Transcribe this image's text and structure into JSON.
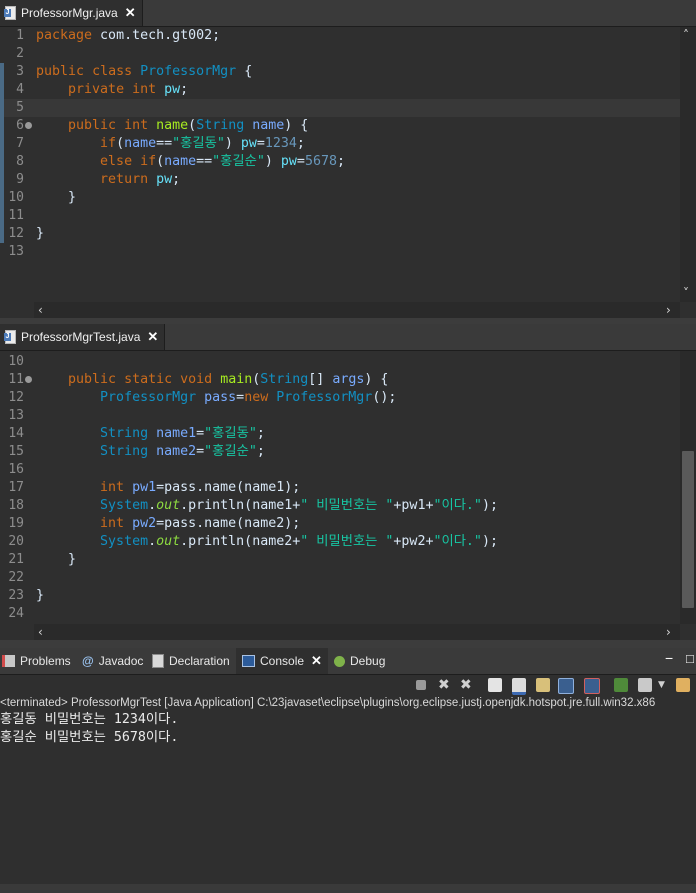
{
  "editor1": {
    "tab_label": "ProfessorMgr.java",
    "close": "✕",
    "lines": [
      "1",
      "2",
      "3",
      "4",
      "5",
      "6",
      "7",
      "8",
      "9",
      "10",
      "11",
      "12",
      "13"
    ],
    "code": {
      "l1a": "package",
      "l1b": " com.tech.gt002;",
      "l3a": "public",
      "l3b": " ",
      "l3c": "class",
      "l3d": " ",
      "l3e": "ProfessorMgr",
      "l3f": " {",
      "l4a": "    ",
      "l4b": "private",
      "l4c": " ",
      "l4d": "int",
      "l4e": " ",
      "l4f": "pw",
      "l4g": ";",
      "l6a": "    ",
      "l6b": "public",
      "l6c": " ",
      "l6d": "int",
      "l6e": " ",
      "l6f": "name",
      "l6g": "(",
      "l6h": "String",
      "l6i": " ",
      "l6j": "name",
      "l6k": ") {",
      "l7a": "        ",
      "l7b": "if",
      "l7c": "(",
      "l7d": "name",
      "l7e": "==",
      "l7f": "\"홍길동\"",
      "l7g": ") ",
      "l7h": "pw",
      "l7i": "=",
      "l7j": "1234",
      "l7k": ";",
      "l8a": "        ",
      "l8b": "else",
      "l8c": " ",
      "l8d": "if",
      "l8e": "(",
      "l8f": "name",
      "l8g": "==",
      "l8h": "\"홍길순\"",
      "l8i": ") ",
      "l8j": "pw",
      "l8k": "=",
      "l8l": "5678",
      "l8m": ";",
      "l9a": "        ",
      "l9b": "return",
      "l9c": " ",
      "l9d": "pw",
      "l9e": ";",
      "l10": "    }",
      "l12": "}"
    }
  },
  "editor2": {
    "tab_label": "ProfessorMgrTest.java",
    "close": "✕",
    "lines": [
      "10",
      "11",
      "12",
      "13",
      "14",
      "15",
      "16",
      "17",
      "18",
      "19",
      "20",
      "21",
      "22",
      "23",
      "24"
    ],
    "code": {
      "l11a": "    ",
      "l11b": "public",
      "l11c": " ",
      "l11d": "static",
      "l11e": " ",
      "l11f": "void",
      "l11g": " ",
      "l11h": "main",
      "l11i": "(",
      "l11j": "String",
      "l11k": "[] ",
      "l11l": "args",
      "l11m": ") {",
      "l12a": "        ",
      "l12b": "ProfessorMgr",
      "l12c": " ",
      "l12d": "pass",
      "l12e": "=",
      "l12f": "new",
      "l12g": " ",
      "l12h": "ProfessorMgr",
      "l12i": "();",
      "l14a": "        ",
      "l14b": "String",
      "l14c": " ",
      "l14d": "name1",
      "l14e": "=",
      "l14f": "\"홍길동\"",
      "l14g": ";",
      "l15a": "        ",
      "l15b": "String",
      "l15c": " ",
      "l15d": "name2",
      "l15e": "=",
      "l15f": "\"홍길순\"",
      "l15g": ";",
      "l17a": "        ",
      "l17b": "int",
      "l17c": " ",
      "l17d": "pw1",
      "l17e": "=pass.name(name1);",
      "l18a": "        ",
      "l18b": "System",
      "l18c": ".",
      "l18d": "out",
      "l18e": ".println(name1+",
      "l18f": "\" 비밀번호는 \"",
      "l18g": "+pw1+",
      "l18h": "\"이다.\"",
      "l18i": ");",
      "l19a": "        ",
      "l19b": "int",
      "l19c": " ",
      "l19d": "pw2",
      "l19e": "=pass.name(name2);",
      "l20a": "        ",
      "l20b": "System",
      "l20c": ".",
      "l20d": "out",
      "l20e": ".println(name2+",
      "l20f": "\" 비밀번호는 \"",
      "l20g": "+pw2+",
      "l20h": "\"이다.\"",
      "l20i": ");",
      "l21": "    }",
      "l23": "}"
    }
  },
  "console_panel": {
    "tabs": [
      {
        "label": "Problems"
      },
      {
        "label": "Javadoc"
      },
      {
        "label": "Declaration"
      },
      {
        "label": "Console",
        "close": "✕"
      },
      {
        "label": "Debug"
      }
    ],
    "status": "<terminated> ProfessorMgrTest [Java Application] C:\\23javaset\\eclipse\\plugins\\org.eclipse.justj.openjdk.hotspot.jre.full.win32.x86",
    "output": [
      "홍길동 비밀번호는 1234이다.",
      "홍길순 비밀번호는 5678이다."
    ]
  },
  "icons": {
    "arrow_left": "‹",
    "arrow_right": "›",
    "arrow_up": "˄",
    "arrow_down": "˅",
    "minimize": "−",
    "maximize": "□"
  },
  "colors": {
    "keyword": "#cc6c1d",
    "type": "#1290c3",
    "field": "#66e1f8",
    "method": "#a7ec21",
    "string": "#17c6a3",
    "number": "#6897bb",
    "background": "#2f2f2f"
  }
}
